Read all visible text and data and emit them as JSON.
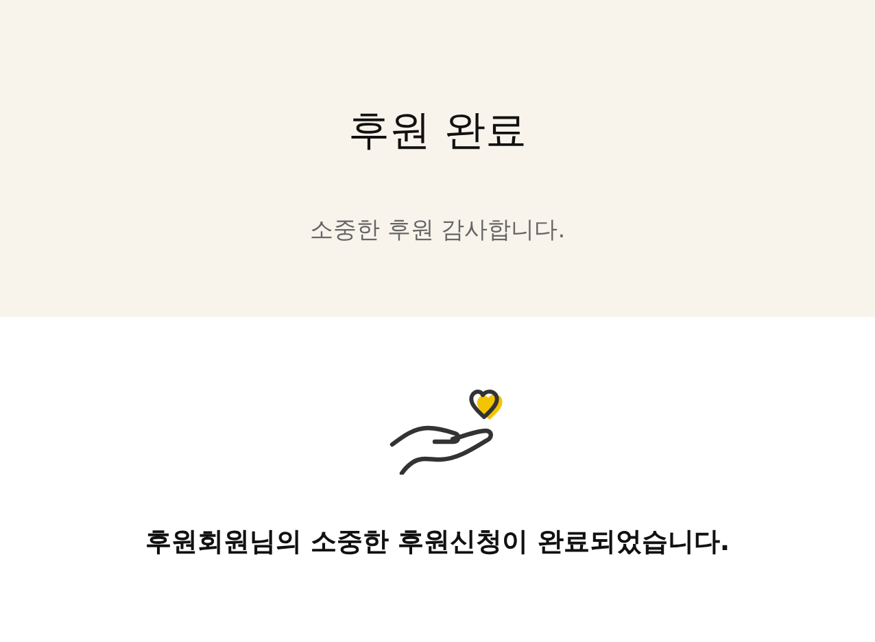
{
  "header": {
    "title": "후원 완료",
    "subtitle": "소중한 후원 감사합니다."
  },
  "message": "후원회원님의 소중한 후원신청이 완료되었습니다."
}
